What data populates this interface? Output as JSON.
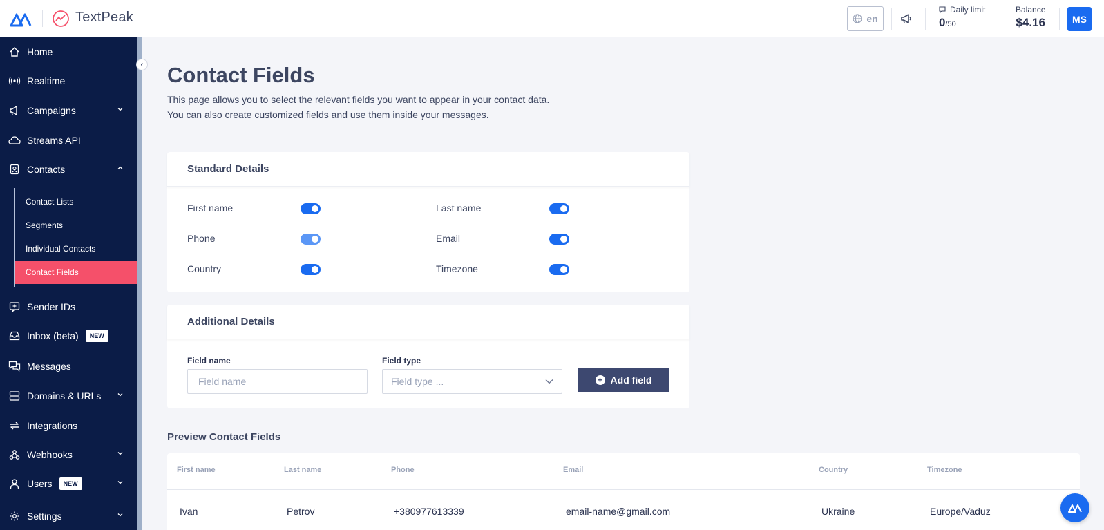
{
  "brand": {
    "name": "TextPeak"
  },
  "topbar": {
    "language": "en",
    "daily_limit": {
      "label": "Daily limit",
      "used": "0",
      "total": "/50"
    },
    "balance": {
      "label": "Balance",
      "value": "$4.16"
    },
    "avatar_initials": "MS"
  },
  "sidebar": {
    "items": [
      {
        "label": "Home",
        "icon": "home-icon"
      },
      {
        "label": "Realtime",
        "icon": "broadcast-icon"
      },
      {
        "label": "Campaigns",
        "icon": "megaphone-icon",
        "chevron": "down"
      },
      {
        "label": "Streams API",
        "icon": "cloud-icon"
      },
      {
        "label": "Contacts",
        "icon": "contacts-icon",
        "chevron": "up"
      },
      {
        "label": "Sender IDs",
        "icon": "sender-id-icon"
      },
      {
        "label": "Inbox (beta)",
        "icon": "inbox-icon",
        "badge": "NEW"
      },
      {
        "label": "Messages",
        "icon": "messages-icon"
      },
      {
        "label": "Domains & URLs",
        "icon": "server-icon",
        "chevron": "down"
      },
      {
        "label": "Integrations",
        "icon": "integrations-icon"
      },
      {
        "label": "Webhooks",
        "icon": "webhooks-icon",
        "chevron": "down"
      },
      {
        "label": "Users",
        "icon": "user-icon",
        "badge": "NEW",
        "chevron": "down"
      },
      {
        "label": "Settings",
        "icon": "settings-icon",
        "chevron": "down"
      }
    ],
    "contacts_sub": [
      {
        "label": "Contact Lists"
      },
      {
        "label": "Segments"
      },
      {
        "label": "Individual Contacts"
      },
      {
        "label": "Contact Fields",
        "active": true
      }
    ]
  },
  "page": {
    "title": "Contact Fields",
    "desc_line1": "This page allows you to select the relevant fields you want to appear in your contact data.",
    "desc_line2": "You can also create customized fields and use them inside your messages."
  },
  "standard": {
    "title": "Standard Details",
    "fields": [
      {
        "label": "First name",
        "enabled": true
      },
      {
        "label": "Last name",
        "enabled": true
      },
      {
        "label": "Phone",
        "enabled": true
      },
      {
        "label": "Email",
        "enabled": true
      },
      {
        "label": "Country",
        "enabled": true
      },
      {
        "label": "Timezone",
        "enabled": true
      }
    ]
  },
  "additional": {
    "title": "Additional Details",
    "field_name_label": "Field name",
    "field_name_placeholder": "Field name",
    "field_type_label": "Field type",
    "field_type_placeholder": "Field type ...",
    "add_button": "Add field"
  },
  "preview": {
    "title": "Preview Contact Fields",
    "headers": [
      "First name",
      "Last name",
      "Phone",
      "Email",
      "Country",
      "Timezone"
    ],
    "row": [
      "Ivan",
      "Petrov",
      "+380977613339",
      "email-name@gmail.com",
      "Ukraine",
      "Europe/Vaduz"
    ]
  },
  "colors": {
    "sidebar_bg": "#0b1c47",
    "accent": "#1a6bf0",
    "active_item": "#f5506a",
    "button": "#3d4870"
  }
}
